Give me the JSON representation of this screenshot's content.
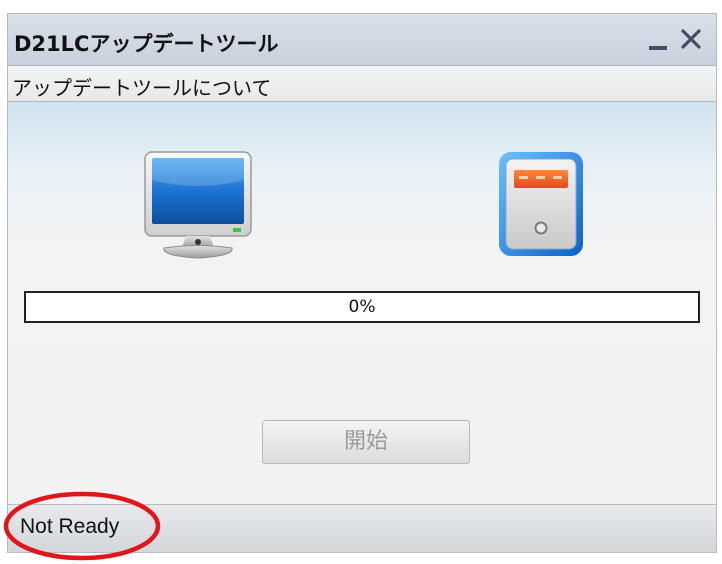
{
  "window": {
    "title": "D21LCアップデートツール",
    "minimize_icon": "minimize-icon",
    "close_icon": "close-icon"
  },
  "menu": {
    "about": "アップデートツールについて"
  },
  "icons": {
    "source": "monitor-icon",
    "target": "usb-drive-icon"
  },
  "progress": {
    "value": 0,
    "label": "0%"
  },
  "actions": {
    "start_label": "開始",
    "start_enabled": false
  },
  "status": {
    "text": "Not Ready"
  },
  "colors": {
    "annotation": "#e0161b",
    "progress_fill": "#3a78d8",
    "drive_accent": "#f05a20"
  }
}
